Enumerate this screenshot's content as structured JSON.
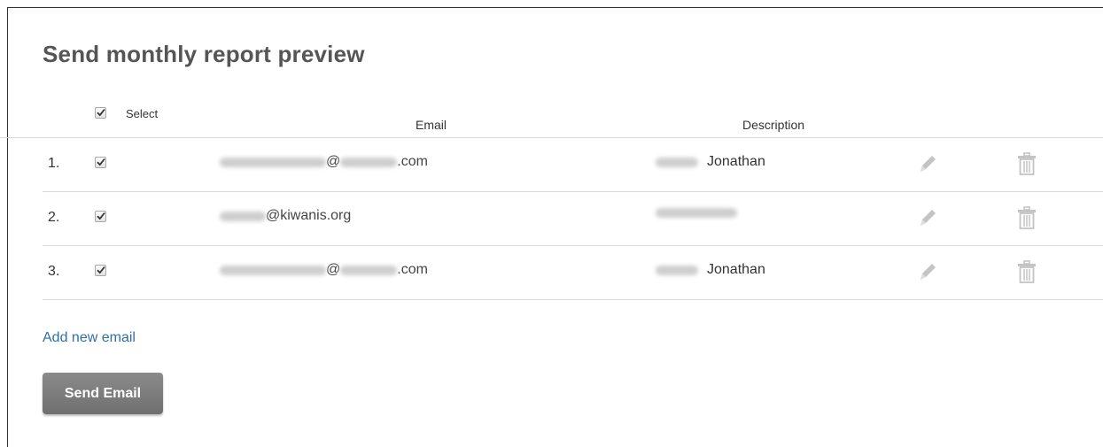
{
  "page": {
    "title": "Send monthly report preview"
  },
  "table": {
    "select_all_checked": true,
    "headers": {
      "select": "Select",
      "email": "Email",
      "description": "Description"
    },
    "rows": [
      {
        "number": "1.",
        "checked": true,
        "email_local_visible": "@",
        "email_domain_visible": ".com",
        "description": "Jonathan"
      },
      {
        "number": "2.",
        "checked": true,
        "email_local_visible": "@kiwanis.org",
        "email_domain_visible": "",
        "description": ""
      },
      {
        "number": "3.",
        "checked": true,
        "email_local_visible": "@",
        "email_domain_visible": ".com",
        "description": "Jonathan"
      }
    ]
  },
  "actions": {
    "add_email_label": "Add new email",
    "send_email_label": "Send Email"
  },
  "icons": {
    "edit": "pencil-icon",
    "delete": "trash-icon",
    "check": "checkmark-icon"
  },
  "colors": {
    "title": "#555555",
    "link": "#2f6fa8",
    "button_bg": "#7a7a7a",
    "button_text": "#ffffff",
    "divider": "#d9d9d9",
    "icon_gray": "#c4c4c4"
  }
}
